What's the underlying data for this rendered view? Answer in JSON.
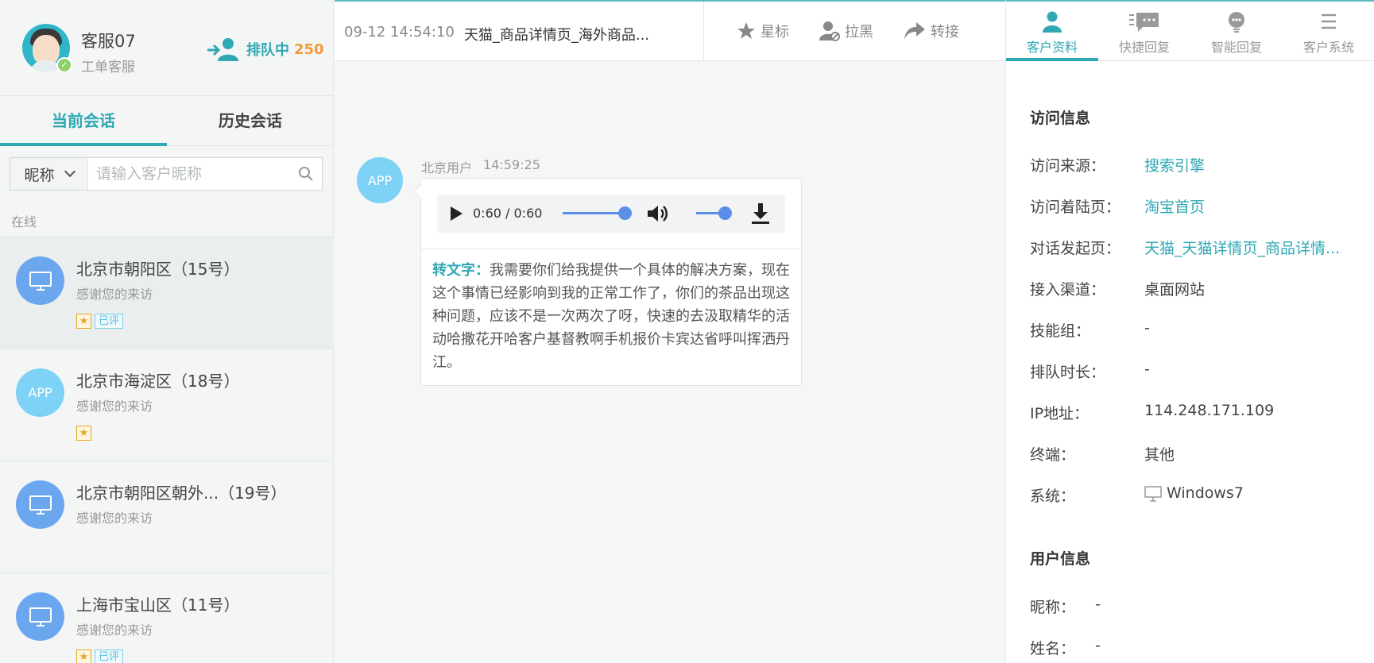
{
  "agent": {
    "name": "客服07",
    "role": "工单客服",
    "queue_label": "排队中",
    "queue_count": "250"
  },
  "left_tabs": [
    {
      "label": "当前会话",
      "active": true
    },
    {
      "label": "历史会话",
      "active": false
    }
  ],
  "search": {
    "select_value": "昵称",
    "placeholder": "请输入客户昵称"
  },
  "online_section_label": "在线",
  "sessions": [
    {
      "avatar": "pc",
      "name": "北京市朝阳区（15号）",
      "last_msg": "感谢您的来访",
      "starred": true,
      "rated_label": "已评",
      "selected": true
    },
    {
      "avatar": "app",
      "avatar_text": "APP",
      "name": "北京市海淀区（18号）",
      "last_msg": "感谢您的来访",
      "starred": true,
      "rated_label": "",
      "selected": false
    },
    {
      "avatar": "pc",
      "name": "北京市朝阳区朝外...（19号）",
      "last_msg": "感谢您的来访",
      "starred": false,
      "rated_label": "",
      "selected": false
    },
    {
      "avatar": "pc",
      "name": "上海市宝山区（11号）",
      "last_msg": "感谢您的来访",
      "starred": true,
      "rated_label": "已评",
      "selected": false
    }
  ],
  "conversation": {
    "time": "09-12 14:54:10",
    "title": "天猫_商品详情页_海外商品..."
  },
  "actions": [
    {
      "label": "星标",
      "icon": "star-icon"
    },
    {
      "label": "拉黑",
      "icon": "block-user-icon"
    },
    {
      "label": "转接",
      "icon": "forward-icon"
    }
  ],
  "message": {
    "avatar_text": "APP",
    "sender": "北京用户",
    "time": "14:59:25",
    "audio_time": "0:60 / 0:60",
    "audio_progress": 1.0,
    "volume": 1.0,
    "transcript_label": "转文字：",
    "transcript_text": "我需要你们给我提供一个具体的解决方案，现在这个事情已经影响到我的正常工作了，你们的茶品出现这种问题，应该不是一次两次了呀，快速的去汲取精华的活动哈撒花开哈客户基督教啊手机报价卡宾达省呼叫挥洒丹江。"
  },
  "right_tabs": [
    {
      "label": "客户资料",
      "icon": "user-icon",
      "active": true
    },
    {
      "label": "快捷回复",
      "icon": "quick-reply-icon",
      "active": false
    },
    {
      "label": "智能回复",
      "icon": "robot-icon",
      "active": false
    },
    {
      "label": "客户系统",
      "icon": "menu-icon",
      "active": false
    }
  ],
  "visit_info": {
    "title": "访问信息",
    "rows": [
      {
        "key": "访问来源：",
        "value": "搜索引擎",
        "link": true
      },
      {
        "key": "访问着陆页：",
        "value": "淘宝首页",
        "link": true
      },
      {
        "key": "对话发起页：",
        "value": "天猫_天猫详情页_商品详情...",
        "link": true
      },
      {
        "key": "接入渠道：",
        "value": "桌面网站",
        "link": false
      },
      {
        "key": "技能组：",
        "value": "-",
        "link": false
      },
      {
        "key": "排队时长：",
        "value": "-",
        "link": false
      },
      {
        "key": "IP地址：",
        "value": "114.248.171.109",
        "link": false
      },
      {
        "key": "终端：",
        "value": "其他",
        "link": false
      },
      {
        "key": "系统：",
        "value": "Windows7",
        "link": false
      }
    ]
  },
  "user_info": {
    "title": "用户信息",
    "rows": [
      {
        "key": "昵称：",
        "value": "-"
      },
      {
        "key": "姓名：",
        "value": "-"
      }
    ]
  },
  "colors": {
    "accent": "#2fa8b3",
    "queue_count": "#f39a3a",
    "pc_avatar": "#6aa7ef",
    "app_avatar": "#7dd2f6",
    "audio_slider": "#5a8ee8"
  }
}
